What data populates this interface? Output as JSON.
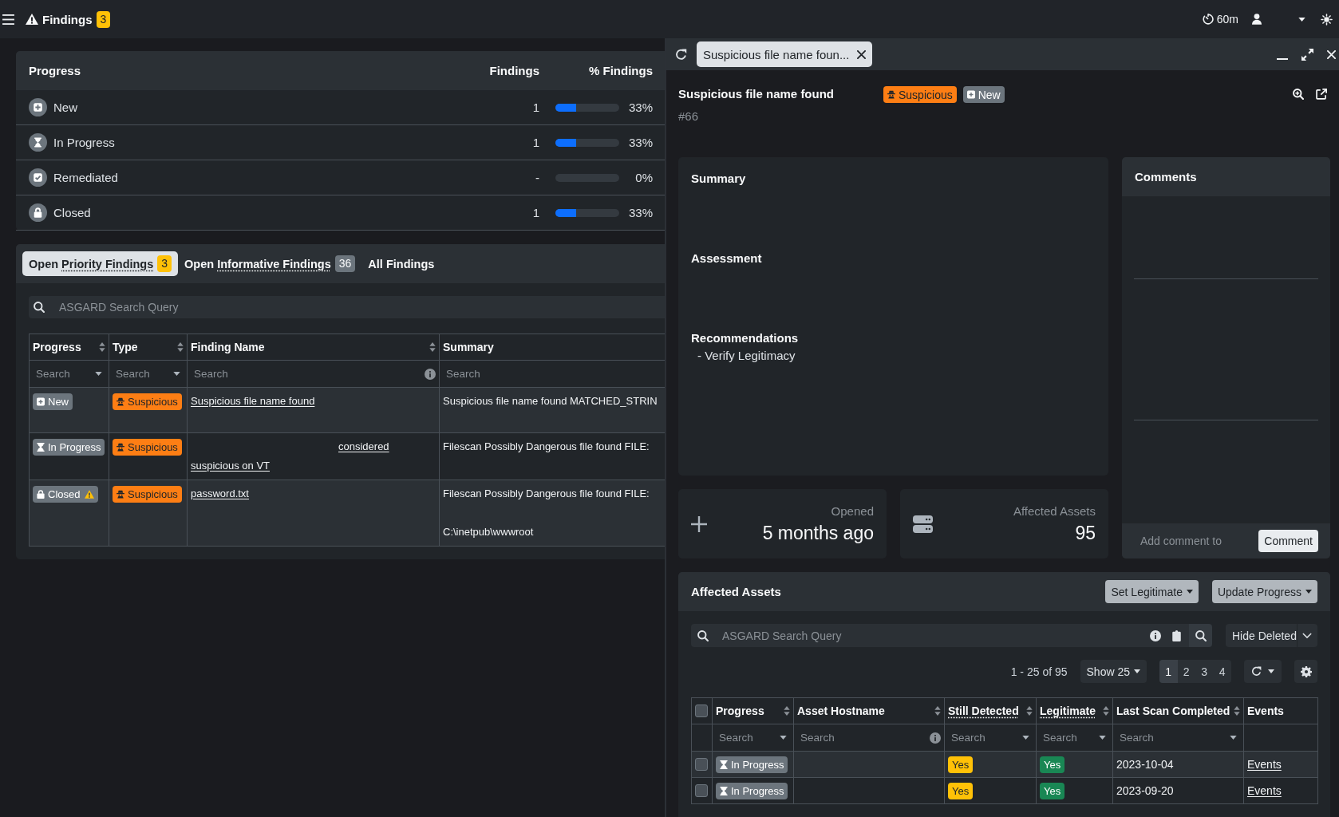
{
  "top_bar": {
    "title": "Findings",
    "count": "3",
    "session_timer": "60m"
  },
  "progress_summary": {
    "columns": [
      "Progress",
      "Findings",
      "% Findings"
    ],
    "rows": [
      {
        "kind": "new",
        "label": "New",
        "count": "1",
        "level": 0.33,
        "percent": "33%"
      },
      {
        "kind": "in_progress",
        "label": "In Progress",
        "count": "1",
        "level": 0.33,
        "percent": "33%"
      },
      {
        "kind": "remediated",
        "label": "Remediated",
        "count": "-",
        "level": 0,
        "percent": "0%"
      },
      {
        "kind": "closed",
        "label": "Closed",
        "count": "1",
        "level": 0.33,
        "percent": "33%"
      }
    ]
  },
  "findings_tabs": [
    {
      "prefix": "Open",
      "label": "Priority Findings",
      "tooltip": true,
      "count": {
        "text": "3",
        "color": "#ffc107"
      },
      "selected": true
    },
    {
      "prefix": "Open",
      "label": "Informative Findings",
      "tooltip": true,
      "count": {
        "text": "36",
        "color": "#6c757d"
      },
      "selected": false
    },
    {
      "label": "All Findings",
      "tooltip": false,
      "selected": false
    }
  ],
  "findings_search": {
    "placeholder": "ASGARD Search Query"
  },
  "findings_table": {
    "columns": [
      {
        "label": "Progress",
        "sortable": true,
        "filter": {
          "kind": "select",
          "placeholder": "Search"
        }
      },
      {
        "label": "Type",
        "sortable": true,
        "filter": {
          "kind": "select",
          "placeholder": "Search"
        }
      },
      {
        "label": "Finding Name",
        "sortable": true,
        "filter": {
          "kind": "query",
          "placeholder": "Search"
        }
      },
      {
        "label": "Summary",
        "sortable": false,
        "filter": {
          "kind": "text",
          "placeholder": "Search"
        }
      }
    ],
    "rows": [
      {
        "progress": {
          "kind": "new",
          "label": "New",
          "warning": false
        },
        "type": {
          "kind": "suspicious",
          "label": "Suspicious"
        },
        "finding_name": {
          "text": "Suspicious file name found",
          "masked": false
        },
        "summary": "Suspicious file name found MATCHED_STRIN"
      },
      {
        "progress": {
          "kind": "in_progress",
          "label": "In Progress",
          "warning": false
        },
        "type": {
          "kind": "suspicious",
          "label": "Suspicious"
        },
        "finding_name": {
          "text": "considered suspicious on VT",
          "masked": true
        },
        "summary": "Filescan Possibly Dangerous file found FILE:"
      },
      {
        "progress": {
          "kind": "closed",
          "label": "Closed",
          "warning": true
        },
        "type": {
          "kind": "suspicious",
          "label": "Suspicious"
        },
        "finding_name": {
          "text": "password.txt",
          "masked": false
        },
        "summary": "Filescan Possibly Dangerous file found FILE:\n\nC:\\inetpub\\wwwroot"
      }
    ]
  },
  "detail_panel": {
    "tab": {
      "label": "Suspicious file name foun..."
    },
    "title": "Suspicious file name found",
    "badges": [
      {
        "kind": "suspicious",
        "label": "Suspicious"
      },
      {
        "kind": "new",
        "label": "New"
      }
    ],
    "number": "#66",
    "sections": [
      {
        "heading": "Summary"
      },
      {
        "heading": "Assessment"
      },
      {
        "heading": "Recommendations",
        "items": [
          "- Verify Legitimacy"
        ]
      }
    ],
    "stats": [
      {
        "kind": "opened",
        "label": "Opened",
        "value": "5 months ago"
      },
      {
        "kind": "assets",
        "label": "Affected Assets",
        "value": "95"
      }
    ],
    "comments": {
      "title": "Comments",
      "placeholder": "Add comment to",
      "button": "Comment"
    }
  },
  "affected_assets": {
    "title": "Affected Assets",
    "actions": [
      "Set Legitimate",
      "Update Progress"
    ],
    "search": {
      "placeholder": "ASGARD Search Query"
    },
    "filter_select": {
      "label": "Hide Deleted"
    },
    "range": "1 - 25 of 95",
    "page_size": "Show 25",
    "pages": [
      {
        "label": "1",
        "selected": true
      },
      {
        "label": "2",
        "selected": false
      },
      {
        "label": "3",
        "selected": false
      },
      {
        "label": "4",
        "selected": false
      }
    ],
    "table": {
      "select_all": {
        "checked": false
      },
      "columns": [
        {
          "label": "Progress",
          "sortable": true,
          "tooltip": false,
          "filter": {
            "kind": "select",
            "placeholder": "Search"
          }
        },
        {
          "label": "Asset Hostname",
          "sortable": true,
          "tooltip": false,
          "filter": {
            "kind": "query",
            "placeholder": "Search"
          }
        },
        {
          "label": "Still Detected",
          "sortable": true,
          "tooltip": true,
          "filter": {
            "kind": "select",
            "placeholder": "Search"
          }
        },
        {
          "label": "Legitimate",
          "sortable": true,
          "tooltip": true,
          "filter": {
            "kind": "select",
            "placeholder": "Search"
          }
        },
        {
          "label": "Last Scan Completed",
          "sortable": true,
          "tooltip": false,
          "filter": {
            "kind": "select",
            "placeholder": "Search"
          }
        },
        {
          "label": "Events",
          "sortable": false,
          "tooltip": false
        }
      ],
      "rows": [
        {
          "checked": false,
          "progress": {
            "kind": "in_progress",
            "label": "In Progress"
          },
          "still_detected": {
            "kind": "warning",
            "label": "Yes"
          },
          "legitimate": {
            "kind": "success",
            "label": "Yes"
          },
          "last_scan": "2023-10-04",
          "events": "Events"
        },
        {
          "checked": false,
          "progress": {
            "kind": "in_progress",
            "label": "In Progress"
          },
          "still_detected": {
            "kind": "warning",
            "label": "Yes"
          },
          "legitimate": {
            "kind": "success",
            "label": "Yes"
          },
          "last_scan": "2023-09-20",
          "events": "Events"
        }
      ]
    }
  }
}
